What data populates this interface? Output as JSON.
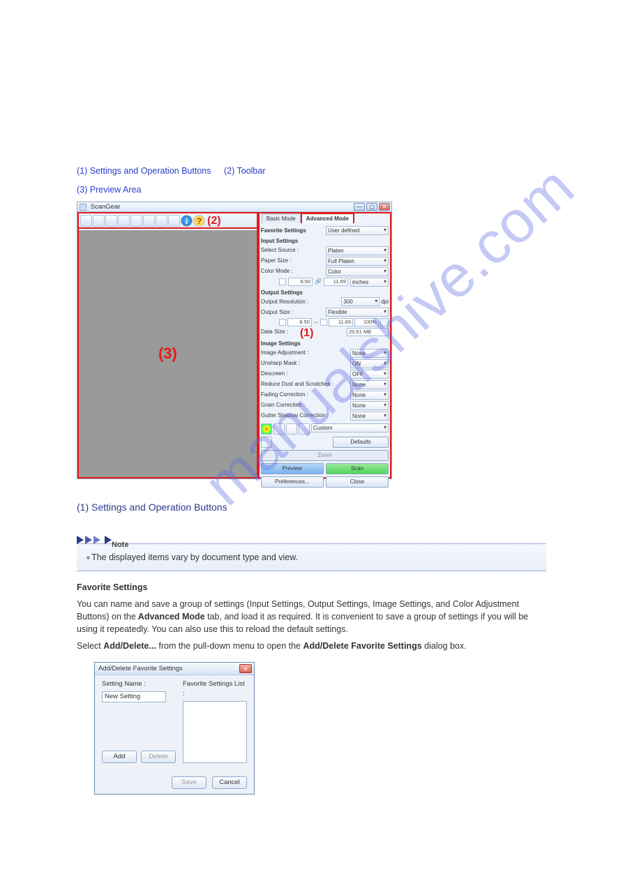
{
  "links": {
    "l1": "(1) Settings and Operation Buttons",
    "l2": "(2) Toolbar",
    "l3": "(3) Preview Area"
  },
  "watermark": "manualshive.com",
  "sg": {
    "title": "ScanGear",
    "winmin": "—",
    "winmax": "▢",
    "winclose": "✕",
    "callout2": "(2)",
    "callout3": "(3)",
    "callout1": "(1)",
    "tab_basic": "Basic Mode",
    "tab_adv": "Advanced Mode",
    "fav_label": "Favorite Settings",
    "fav_value": "User defined",
    "input_section": "Input Settings",
    "select_source_label": "Select Source :",
    "select_source_value": "Platen",
    "paper_size_label": "Paper Size :",
    "paper_size_value": "Full Platen",
    "color_mode_label": "Color Mode :",
    "color_mode_value": "Color",
    "in_w": "8.50",
    "in_h": "11.69",
    "in_unit": "inches",
    "output_section": "Output Settings",
    "out_res_label": "Output Resolution :",
    "out_res_value": "300",
    "out_res_unit": "dpi",
    "out_size_label": "Output Size :",
    "out_size_value": "Flexible",
    "out_w": "8.50",
    "out_h": "11.69",
    "out_pct": "100%",
    "data_size_label": "Data Size :",
    "data_size_value": "25.61 MB",
    "image_section": "Image Settings",
    "img_adj_label": "Image Adjustment :",
    "img_adj_value": "None",
    "unsharp_label": "Unsharp Mask :",
    "unsharp_value": "ON",
    "descreen_label": "Descreen :",
    "descreen_value": "OFF",
    "dust_label": "Reduce Dust and Scratches :",
    "dust_value": "None",
    "fading_label": "Fading Correction :",
    "fading_value": "None",
    "grain_label": "Grain Correction :",
    "grain_value": "None",
    "gutter_label": "Gutter Shadow Correction :",
    "gutter_value": "None",
    "custom": "Custom",
    "defaults": "Defaults",
    "zoom": "Zoom",
    "preview": "Preview",
    "scan": "Scan",
    "prefs": "Preferences...",
    "close": "Close"
  },
  "section1": {
    "heading": "(1) Settings and Operation Buttons",
    "note_label": "Note",
    "note_text": "The displayed items vary by document type and view.",
    "fav_label": "Favorite Settings",
    "fav_para1": "You can name and save a group of settings (Input Settings, Output Settings, Image Settings, and Color Adjustment Buttons) on the",
    "fav_tabbold": " Advanced Mode ",
    "fav_para1b": "tab, and load it as required. It is convenient to save a group of settings if you will be using it repeatedly. You can also use this to reload the default settings.",
    "fav_para2a": "Select ",
    "fav_addbold": "Add/Delete...",
    "fav_para2b": " from the pull-down menu to open the ",
    "fav_dlgbold": "Add/Delete Favorite Settings",
    "fav_para2c": " dialog box."
  },
  "dlg": {
    "title": "Add/Delete Favorite Settings",
    "close": "✕",
    "setting_name_label": "Setting Name :",
    "setting_name_value": "New Setting",
    "list_label": "Favorite Settings List :",
    "add": "Add",
    "delete": "Delete",
    "save": "Save",
    "cancel": "Cancel"
  }
}
